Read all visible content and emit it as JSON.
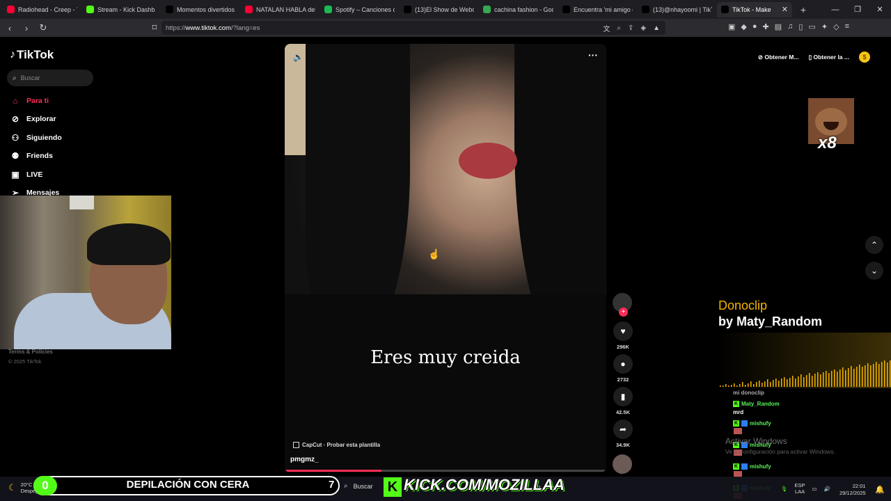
{
  "browser": {
    "tabs": [
      {
        "title": "Radiohead - Creep - Yo",
        "color": "#ff0033"
      },
      {
        "title": "Stream - Kick Dashb",
        "color": "#53fc18"
      },
      {
        "title": "Momentos divertidos",
        "color": "#000000"
      },
      {
        "title": "NATALAN HABLA del T",
        "color": "#ff0033"
      },
      {
        "title": "Spotify – Canciones qu",
        "color": "#1db954"
      },
      {
        "title": "(13)El Show de Webon",
        "color": "#000000"
      },
      {
        "title": "cachina fashion - Goog",
        "color": "#34a853"
      },
      {
        "title": "Encuentra 'mi amigo g",
        "color": "#000000"
      },
      {
        "title": "(13)@nhayoomi | TikTo",
        "color": "#000000"
      },
      {
        "title": "TikTok - Make",
        "color": "#000000",
        "active": true
      }
    ],
    "url_prefix": "https://",
    "url_host": "www.tiktok.com",
    "url_path": "/?lang=es"
  },
  "sidebar": {
    "logo": "TikTok",
    "search_placeholder": "Buscar",
    "items": [
      {
        "label": "Para ti",
        "icon": "home-icon"
      },
      {
        "label": "Explorar",
        "icon": "compass-icon"
      },
      {
        "label": "Siguiendo",
        "icon": "following-icon"
      },
      {
        "label": "Friends",
        "icon": "friends-icon"
      },
      {
        "label": "LIVE",
        "icon": "live-icon"
      },
      {
        "label": "Mensajes",
        "icon": "messages-icon"
      }
    ],
    "terms": "Terms & Policies",
    "copyright": "© 2025 TikTok"
  },
  "video": {
    "caption": "Eres muy creida",
    "capcut": "CapCut · Probar esta plantilla",
    "author": "pmgmz_",
    "progress": 0.3,
    "actions": [
      {
        "name": "like",
        "icon": "♥",
        "count": "296K"
      },
      {
        "name": "comment",
        "icon": "●",
        "count": "2732"
      },
      {
        "name": "bookmark",
        "icon": "▮",
        "count": "42.5K"
      },
      {
        "name": "share",
        "icon": "➦",
        "count": "34.9K"
      }
    ]
  },
  "topbar": {
    "btn1": "Obtener M...",
    "btn2": "Obtener la ..."
  },
  "overlay": {
    "emote_multiplier": "x8",
    "donoclip_title": "Donoclip",
    "donoclip_by": "by Maty_Random",
    "chat": [
      {
        "user": "",
        "msg": "mi donoclip"
      },
      {
        "user": "Maty_Random",
        "msg": "mrd"
      },
      {
        "user": "mishufy",
        "msg": ""
      },
      {
        "user": "mishufy",
        "msg": ""
      },
      {
        "user": "mishufy",
        "msg": ""
      },
      {
        "user": "mishufy",
        "msg": ""
      }
    ],
    "activate_title": "Activar Windows",
    "activate_sub": "Ve a Configuración para activar Windows.",
    "banner_num": "0",
    "banner_text": "DEPILACIÓN CON CERA",
    "banner_count": "7",
    "kick_url": "KICK.COM/MOZILLAA"
  },
  "taskbar": {
    "temp": "20°C",
    "weather": "Despej",
    "search": "Buscar",
    "lang1": "ESP",
    "lang2": "LAA",
    "time": "22:01",
    "date": "29/12/2025"
  }
}
